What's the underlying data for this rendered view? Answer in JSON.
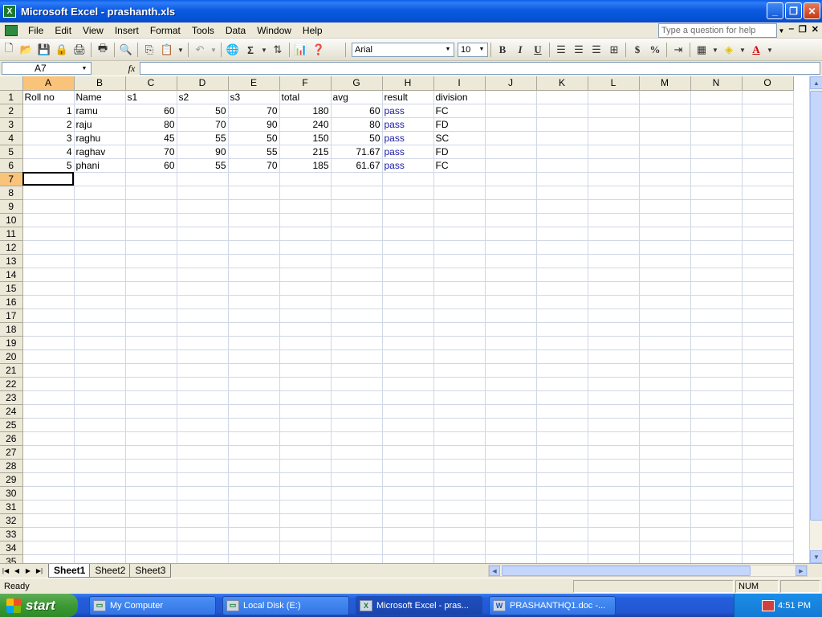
{
  "window": {
    "title": "Microsoft Excel - prashanth.xls",
    "min": "_",
    "max": "❐",
    "close": "✕"
  },
  "menu": {
    "items": [
      "File",
      "Edit",
      "View",
      "Insert",
      "Format",
      "Tools",
      "Data",
      "Window",
      "Help"
    ],
    "help_placeholder": "Type a question for help"
  },
  "toolbar": {
    "font": "Arial",
    "size": "10",
    "bold": "B",
    "italic": "I",
    "underline": "U",
    "sum": "Σ",
    "currency": "$",
    "percent": "%"
  },
  "formula_bar": {
    "name_box": "A7",
    "fx": "fx",
    "value": ""
  },
  "columns": [
    "A",
    "B",
    "C",
    "D",
    "E",
    "F",
    "G",
    "H",
    "I",
    "J",
    "K",
    "L",
    "M",
    "N",
    "O"
  ],
  "rows": [
    [
      "Roll no",
      "Name",
      "s1",
      "s2",
      "s3",
      "total",
      "avg",
      "result",
      "division"
    ],
    [
      "1",
      "ramu",
      "60",
      "50",
      "70",
      "180",
      "60",
      "pass",
      "FC"
    ],
    [
      "2",
      "raju",
      "80",
      "70",
      "90",
      "240",
      "80",
      "pass",
      "FD"
    ],
    [
      "3",
      "raghu",
      "45",
      "55",
      "50",
      "150",
      "50",
      "pass",
      "SC"
    ],
    [
      "4",
      "raghav",
      "70",
      "90",
      "55",
      "215",
      "71.67",
      "pass",
      "FD"
    ],
    [
      "5",
      "phani",
      "60",
      "55",
      "70",
      "185",
      "61.67",
      "pass",
      "FC"
    ]
  ],
  "row_count": 35,
  "sheets": [
    "Sheet1",
    "Sheet2",
    "Sheet3"
  ],
  "active_sheet": "Sheet1",
  "status": {
    "ready": "Ready",
    "num": "NUM"
  },
  "taskbar": {
    "start": "start",
    "tasks": [
      "My Computer",
      "Local Disk (E:)",
      "Microsoft Excel - pras...",
      "PRASHANTHQ1.doc -..."
    ],
    "clock": "4:51 PM"
  }
}
